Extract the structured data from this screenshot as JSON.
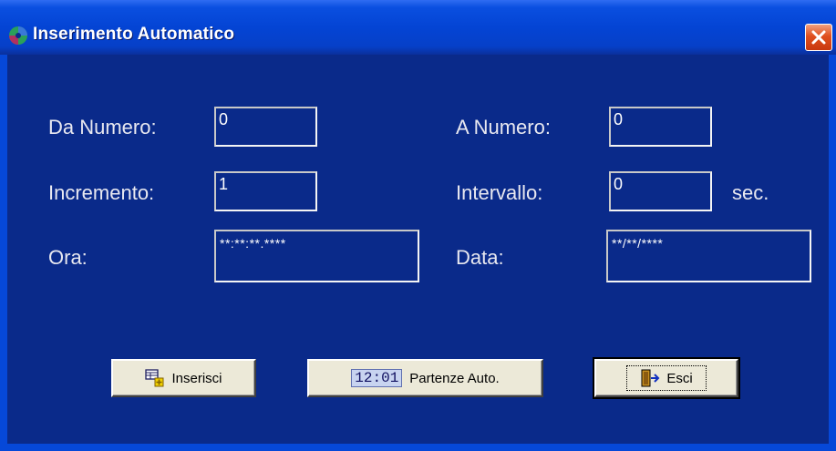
{
  "window": {
    "title": "Inserimento Automatico",
    "icon": "app-swirl-icon",
    "close_icon": "close-x-icon",
    "colors": {
      "background": "#0a2a8a",
      "titlebar": "#0444d4",
      "close": "#e0501e"
    }
  },
  "form": {
    "da_numero": {
      "label": "Da Numero:",
      "value": "0"
    },
    "a_numero": {
      "label": "A Numero:",
      "value": "0"
    },
    "incremento": {
      "label": "Incremento:",
      "value": "1"
    },
    "intervallo": {
      "label": "Intervallo:",
      "value": "0",
      "unit": "sec."
    },
    "ora": {
      "label": "Ora:",
      "value": "**:**:**.****"
    },
    "data": {
      "label": "Data:",
      "value": "**/**/****"
    }
  },
  "buttons": {
    "inserisci": {
      "label": "Inserisci",
      "icon": "insert-table-icon"
    },
    "partenze": {
      "label": "Partenze Auto.",
      "badge": "12:01",
      "icon": "clock-badge-icon"
    },
    "esci": {
      "label": "Esci",
      "icon": "exit-door-icon"
    }
  }
}
